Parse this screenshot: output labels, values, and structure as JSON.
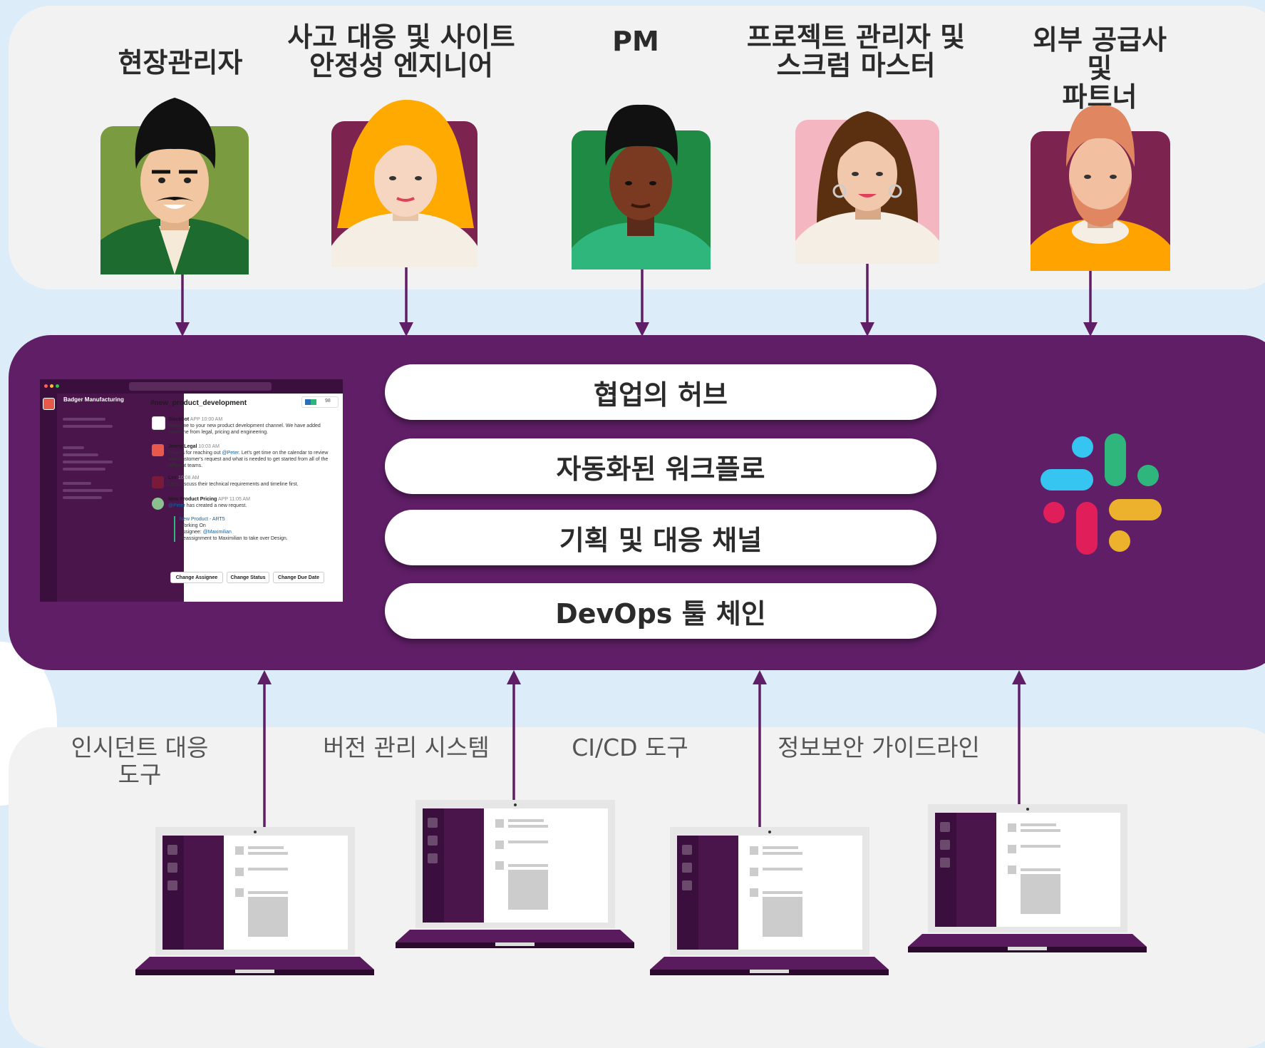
{
  "personas": [
    {
      "name": "현장관리자"
    },
    {
      "name": "사고 대응 및 사이트\n안정성 엔지니어"
    },
    {
      "name": "PM"
    },
    {
      "name": "프로젝트 관리자 및\n스크럼 마스터"
    },
    {
      "name": "외부 공급사 및\n파트너"
    }
  ],
  "hub": {
    "pills": [
      "협업의 허브",
      "자동화된 워크플로",
      "기획 및 대응 채널",
      "DevOps 툴 체인"
    ]
  },
  "slack_screenshot": {
    "workspace": "Badger Manufacturing",
    "channel": "#new_product_development",
    "member_count": "98",
    "messages": [
      {
        "author": "Slackbot",
        "tag": "APP",
        "time": "10:00 AM",
        "text": "Welcome to your new product development channel. We have added everyone from legal, pricing and engineering."
      },
      {
        "author": "Jenny Legal",
        "tag": "",
        "time": "10:03 AM",
        "text_before": "Thanks for reaching out ",
        "mention": "@Peter",
        "text_after": ". Let's get time on the calendar to review your customer's request and what is needed to get started from all of the different teams."
      },
      {
        "author": "Lee",
        "tag": "",
        "time": "10:08 AM",
        "text": "Let's discuss their technical requirements and timeline first."
      },
      {
        "author": "New Product Pricing",
        "tag": "APP",
        "time": "11:05 AM",
        "mention": "@Peter",
        "text": " has created a new request."
      }
    ],
    "request": {
      "title": "New Product - ART5",
      "status": "Working On",
      "assignee_label": "Assignee: ",
      "assignee": "@Maximilian",
      "note": "Reassignment to Maximilian to take over Design."
    },
    "buttons": [
      "Change Assignee",
      "Change Status",
      "Change Due Date"
    ]
  },
  "tools": [
    {
      "label": "인시던트 대응\n도구"
    },
    {
      "label": "버전 관리 시스템"
    },
    {
      "label": "CI/CD 도구"
    },
    {
      "label": "정보보안 가이드라인"
    }
  ],
  "colors": {
    "hub_purple": "#5f1e66",
    "arrow": "#5f1e66",
    "panel": "#f2f2f2",
    "background": "#dcecf8",
    "slack_blue": "#36c5f0",
    "slack_green": "#2eb67d",
    "slack_red": "#e01e5a",
    "slack_yellow": "#ecb22e"
  },
  "icons": {
    "hub_logo": "slack-logo-icon"
  }
}
